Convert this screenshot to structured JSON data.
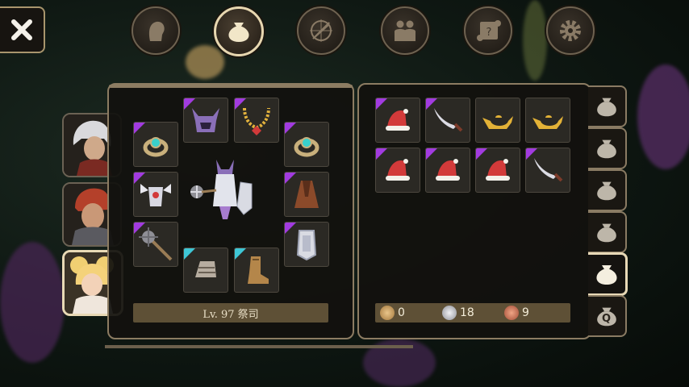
{
  "header": {
    "tabs": [
      {
        "icon": "head-silhouette-icon",
        "active": false
      },
      {
        "icon": "bag-icon",
        "active": true
      },
      {
        "icon": "compass-sword-icon",
        "active": false
      },
      {
        "icon": "party-icon",
        "active": false
      },
      {
        "icon": "scroll-icon",
        "active": false
      },
      {
        "icon": "gear-icon",
        "active": false
      }
    ]
  },
  "party": [
    {
      "icon": "white-haired-hero-portrait",
      "active": false
    },
    {
      "icon": "red-haired-warrior-portrait",
      "active": false
    },
    {
      "icon": "blonde-priestess-portrait",
      "active": true
    }
  ],
  "equipment": {
    "level_label": "Lv. 97 祭司",
    "slots": [
      {
        "name": "ring-left",
        "item": "ring",
        "rarity": "epic"
      },
      {
        "name": "helmet",
        "item": "horned-helm",
        "rarity": "epic"
      },
      {
        "name": "necklace",
        "item": "necklace",
        "rarity": "epic"
      },
      {
        "name": "ring-right",
        "item": "ring",
        "rarity": "epic"
      },
      {
        "name": "armor",
        "item": "winged-armor",
        "rarity": "epic"
      },
      {
        "name": "cloak",
        "item": "cloak",
        "rarity": "epic"
      },
      {
        "name": "weapon",
        "item": "mace",
        "rarity": "epic"
      },
      {
        "name": "shield",
        "item": "shield",
        "rarity": "epic"
      },
      {
        "name": "gloves",
        "item": "gauntlets",
        "rarity": "rare"
      },
      {
        "name": "boots",
        "item": "boots",
        "rarity": "rare"
      }
    ]
  },
  "inventory": {
    "items": [
      {
        "item": "santa-hat",
        "rarity": "epic"
      },
      {
        "item": "scimitar",
        "rarity": "epic"
      },
      {
        "item": "magic-lamp",
        "rarity": "normal"
      },
      {
        "item": "magic-lamp",
        "rarity": "normal"
      },
      {
        "item": "santa-hat",
        "rarity": "epic"
      },
      {
        "item": "santa-hat",
        "rarity": "epic"
      },
      {
        "item": "santa-hat",
        "rarity": "epic"
      },
      {
        "item": "scimitar",
        "rarity": "epic"
      }
    ],
    "currency": {
      "gold": "0",
      "silver": "18",
      "copper": "9"
    }
  },
  "side_tabs": [
    {
      "icon": "bag-icon",
      "active": false
    },
    {
      "icon": "bag-icon",
      "active": false
    },
    {
      "icon": "bag-icon",
      "active": false
    },
    {
      "icon": "bag-icon",
      "active": false
    },
    {
      "icon": "bag-icon",
      "active": true
    },
    {
      "icon": "quest-bag-icon",
      "label": "Q",
      "active": false
    }
  ],
  "colors": {
    "epic": "#a23be0",
    "rare": "#3ec7d6",
    "panel_border": "#8c7c62",
    "label_bar": "#5e5036"
  }
}
